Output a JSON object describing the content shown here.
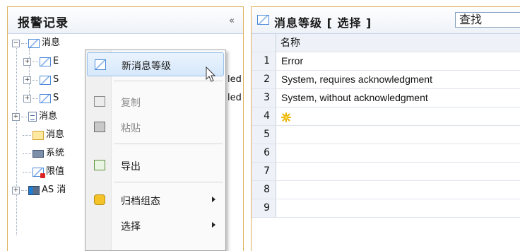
{
  "left_pane": {
    "title": "报警记录",
    "collapse_glyph": "«",
    "tree": [
      {
        "label": "消息",
        "icon": "envelope-icon",
        "expander": "−"
      },
      {
        "label": "E",
        "icon": "envelope-icon",
        "expander": "+"
      },
      {
        "label": "S",
        "suffix": "led",
        "icon": "envelope-icon",
        "expander": "+"
      },
      {
        "label": "S",
        "suffix": "led",
        "icon": "envelope-icon",
        "expander": "+"
      },
      {
        "label": "消息",
        "icon": "document-icon",
        "expander": "+"
      },
      {
        "label": "消息",
        "icon": "yellow-envelope-icon"
      },
      {
        "label": "系统",
        "icon": "computer-icon"
      },
      {
        "label": "限值",
        "icon": "alert-envelope-icon"
      },
      {
        "label": "AS 消",
        "icon": "server-icon",
        "expander": "+"
      }
    ]
  },
  "context_menu": {
    "items": [
      {
        "label": "新消息等级",
        "icon": "envelope-icon",
        "highlighted": true,
        "enabled": true
      },
      {
        "label": "复制",
        "icon": "copy-icon",
        "enabled": false
      },
      {
        "label": "粘贴",
        "icon": "paste-icon",
        "enabled": false
      },
      {
        "label": "导出",
        "icon": "export-icon",
        "enabled": true
      },
      {
        "label": "归档组态",
        "icon": "archive-icon",
        "enabled": true,
        "submenu": true
      },
      {
        "label": "选择",
        "enabled": true,
        "submenu": true
      }
    ]
  },
  "right_pane": {
    "title": "消息等级 [ 选择 ]",
    "search_value": "查找",
    "column_header": "名称",
    "rows": [
      {
        "num": "1",
        "name": "Error"
      },
      {
        "num": "2",
        "name": "System, requires acknowledgment"
      },
      {
        "num": "3",
        "name": "System, without acknowledgment"
      },
      {
        "num": "4",
        "name": "",
        "new_row_icon": "sparkle-icon"
      },
      {
        "num": "5",
        "name": ""
      },
      {
        "num": "6",
        "name": ""
      },
      {
        "num": "7",
        "name": ""
      },
      {
        "num": "8",
        "name": ""
      },
      {
        "num": "9",
        "name": ""
      }
    ]
  },
  "colors": {
    "pane_border": "#e1b25f",
    "menu_highlight": "#d6e8fb",
    "accent_blue": "#4a89d8"
  }
}
